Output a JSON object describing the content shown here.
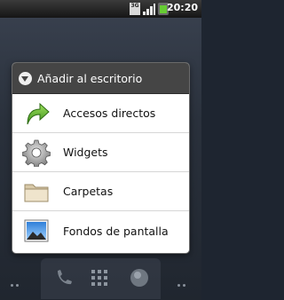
{
  "statusbar": {
    "network_label": "3G",
    "time": "20:20"
  },
  "dialog": {
    "title": "Añadir al escritorio",
    "items": [
      {
        "label": "Accesos directos",
        "icon": "shortcut-arrow-icon"
      },
      {
        "label": "Widgets",
        "icon": "gear-icon"
      },
      {
        "label": "Carpetas",
        "icon": "folder-icon"
      },
      {
        "label": "Fondos de pantalla",
        "icon": "wallpaper-icon"
      }
    ]
  },
  "dock": {
    "buttons": [
      "phone-icon",
      "apps-grid-icon",
      "browser-globe-icon"
    ]
  },
  "colors": {
    "header_bg": "#454545",
    "item_bg": "#ffffff",
    "accent_green": "#66cc33"
  }
}
